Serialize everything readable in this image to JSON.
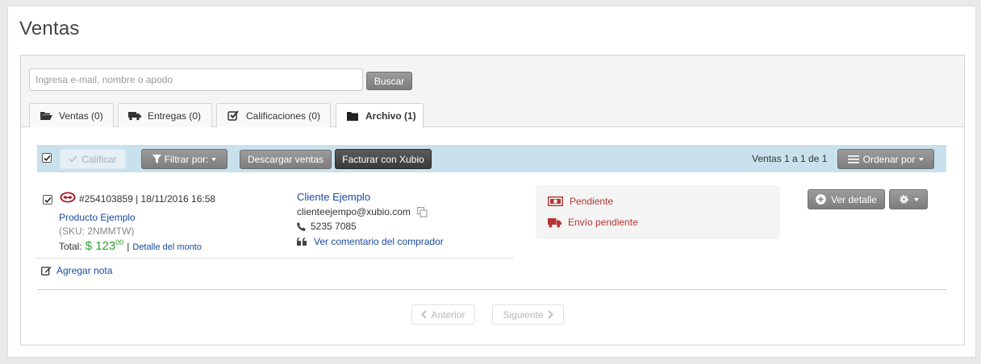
{
  "page": {
    "title": "Ventas"
  },
  "search": {
    "placeholder": "Ingresa e-mail, nombre o apodo",
    "button_label": "Buscar"
  },
  "tabs": [
    {
      "label": "Ventas (0)",
      "icon": "folder-open-icon"
    },
    {
      "label": "Entregas (0)",
      "icon": "truck-icon"
    },
    {
      "label": "Calificaciones (0)",
      "icon": "check-square-icon"
    },
    {
      "label": "Archivo (1)",
      "icon": "folder-icon",
      "active": true
    }
  ],
  "toolbar": {
    "rate_label": "Calificar",
    "filter_label": "Filtrar por:",
    "download_label": "Descargar ventas",
    "xubio_label": "Facturar con Xubio",
    "count_label": "Ventas 1 a 1 de 1",
    "sort_label": "Ordenar por",
    "select_all_checked": true
  },
  "order": {
    "checked": true,
    "id_date": "#254103859 | 18/11/2016 16:58",
    "product": "Producto Ejemplo",
    "sku": "(SKU: 2NMMTW)",
    "total_label": "Total:",
    "total_currency": "$ 123",
    "total_cents": "00",
    "detail_link": "Detalle del monto",
    "add_note": "Agregar nota",
    "buyer_name": "Cliente Ejemplo",
    "buyer_email": "clienteejempo@xubio.com",
    "buyer_phone": "5235 7085",
    "buyer_comment": "Ver comentario del comprador",
    "payment_status": "Pendiente",
    "shipping_status": "Envío pendiente",
    "detail_button": "Ver detalle"
  },
  "pagination": {
    "prev_label": "Anterior",
    "next_label": "Siguiente"
  },
  "colors": {
    "toolbar_bg": "#c9e1ec",
    "status_red": "#b73434",
    "link_blue": "#1a4a9c",
    "amount_green": "#2d9f2d"
  }
}
